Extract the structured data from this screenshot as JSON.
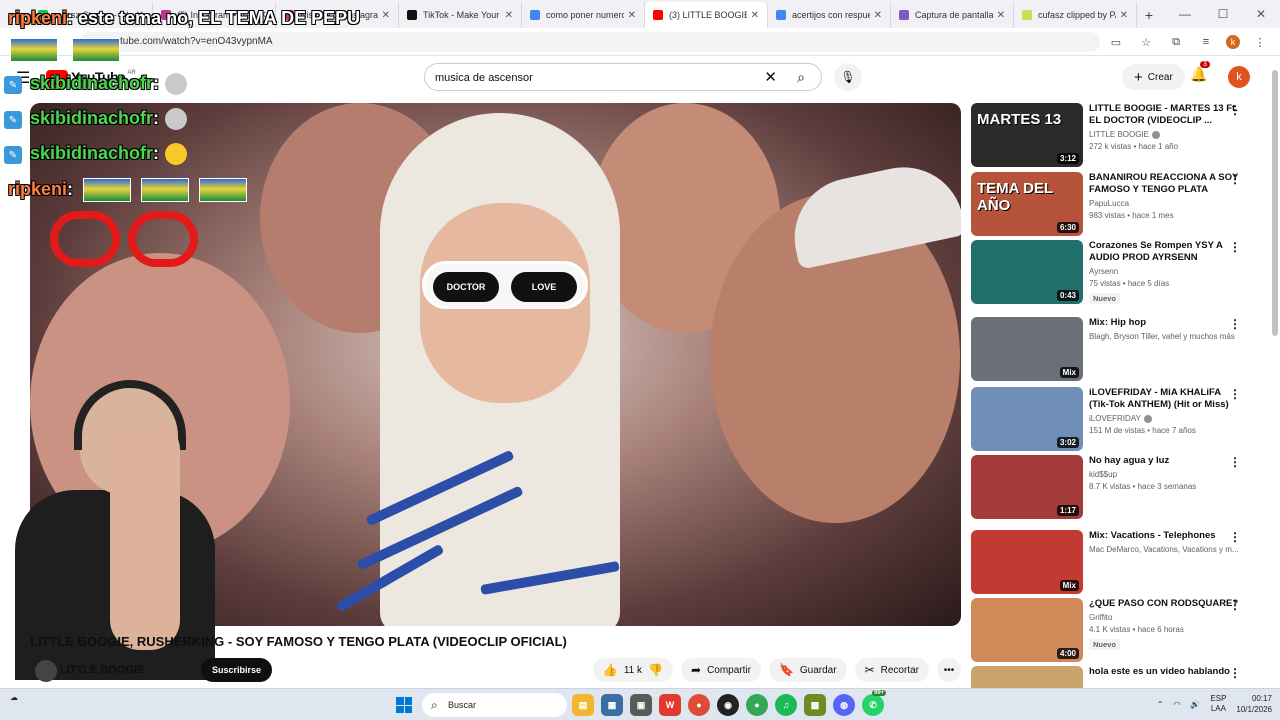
{
  "browser": {
    "tabs": [
      {
        "label": "cufasz Stream - Watc",
        "color": "#1db954"
      },
      {
        "label": "(5) Instagram • Mens",
        "color": "#c13584"
      },
      {
        "label": "Historia de Instagram",
        "color": "#c13584"
      },
      {
        "label": "TikTok - Make Your D",
        "color": "#111111"
      },
      {
        "label": "como poner numero",
        "color": "#4285f4"
      },
      {
        "label": "(3) LITTLE BOOGIE",
        "color": "#ff0000",
        "active": true
      },
      {
        "label": "acertijos con respues",
        "color": "#4285f4"
      },
      {
        "label": "Captura de pantalla",
        "color": "#7e57c2"
      },
      {
        "label": "cufasz clipped by PAS",
        "color": "#c6e34f"
      }
    ],
    "new_tab": "+",
    "url": "tube.com/watch?v=enO43vypnMA",
    "profile_initial": "k"
  },
  "youtube": {
    "logo": "YouTube",
    "region": "AR",
    "search_query": "musica de ascensor",
    "create_label": "Crear",
    "notifications": "3",
    "avatar_initial": "k"
  },
  "chat_overlay": [
    {
      "user": "ripkeni",
      "message": ": este tema no, EL TEMA DE PEPU"
    },
    {
      "user": "skibidinachofr",
      "message": ":"
    },
    {
      "user": "skibidinachofr",
      "message": ":"
    },
    {
      "user": "skibidinachofr",
      "message": ":"
    },
    {
      "user": "ripkeni",
      "message": ":"
    }
  ],
  "video": {
    "lens_left": "DOCTOR",
    "lens_right": "LOVE",
    "title": "LITTLE BOOGIE, RUSHERKING - SOY FAMOSO Y TENGO PLATA (VIDEOCLIP OFICIAL)",
    "channel": "LITTLE BOOGIE",
    "subscribe_label": "Suscribirse",
    "like_count": "11 k",
    "share_label": "Compartir",
    "save_label": "Guardar",
    "clip_label": "Recortar",
    "more": "•••"
  },
  "recommendations": [
    {
      "title": "LITTLE BOOGIE - MARTES 13 Ft. EL DOCTOR (VIDEOCLIP ...",
      "channel": "LITTLE BOOGIE",
      "verified": true,
      "meta": "272 k vistas • hace 1 año",
      "duration": "3:12",
      "badge": "",
      "thumb_text": "MARTES 13",
      "bg": "#2b2b2b"
    },
    {
      "title": "BANANIROU REACCIONA A SOY FAMOSO Y TENGO PLATA",
      "channel": "PapuLucca",
      "verified": false,
      "meta": "983 vistas • hace 1 mes",
      "duration": "6:30",
      "badge": "",
      "thumb_text": "TEMA DEL AÑO",
      "bg": "#b5543a"
    },
    {
      "title": "Corazones Se Rompen YSY A AUDIO PROD AYRSENN",
      "channel": "Ayrsenn",
      "verified": false,
      "meta": "75 vistas • hace 5 días",
      "duration": "0:43",
      "badge": "Nuevo",
      "thumb_text": "",
      "bg": "#1f6f6a"
    },
    {
      "title": "Mix: Hip hop",
      "channel": "Blagh, Bryson Tiller, vahel y muchos más",
      "verified": false,
      "meta": "",
      "duration": "Mix",
      "badge": "",
      "thumb_text": "",
      "bg": "#6b7078"
    },
    {
      "title": "iLOVEFRIDAY - MiA KHALiFA (Tik-Tok ANTHEM) (Hit or Miss)",
      "channel": "iLOVEFRIDAY",
      "verified": true,
      "meta": "151 M de vistas • hace 7 años",
      "duration": "3:02",
      "badge": "",
      "thumb_text": "",
      "bg": "#6f8fb8"
    },
    {
      "title": "No hay agua y luz",
      "channel": "kid$$up",
      "verified": false,
      "meta": "8.7 K vistas • hace 3 semanas",
      "duration": "1:17",
      "badge": "",
      "thumb_text": "",
      "bg": "#a33b3b"
    },
    {
      "title": "Mix: Vacations - Telephones",
      "channel": "Mac DeMarco, Vacations, Vacations y m...",
      "verified": false,
      "meta": "",
      "duration": "Mix",
      "badge": "",
      "thumb_text": "",
      "bg": "#c23b33"
    },
    {
      "title": "¿QUE PASO CON RODSQUARE?",
      "channel": "Griffito",
      "verified": false,
      "meta": "4.1 K vistas • hace 6 horas",
      "duration": "4:00",
      "badge": "Nuevo",
      "thumb_text": "",
      "bg": "#d08a5a"
    },
    {
      "title": "hola este es un video hablando",
      "channel": "",
      "verified": false,
      "meta": "",
      "duration": "",
      "badge": "",
      "thumb_text": "",
      "bg": "#c9a36a"
    }
  ],
  "taskbar": {
    "search_label": "Buscar",
    "tray_badge": "99+",
    "lang_1": "ESP",
    "lang_2": "LAA",
    "time": "00:17",
    "date": "10/1/2026"
  }
}
